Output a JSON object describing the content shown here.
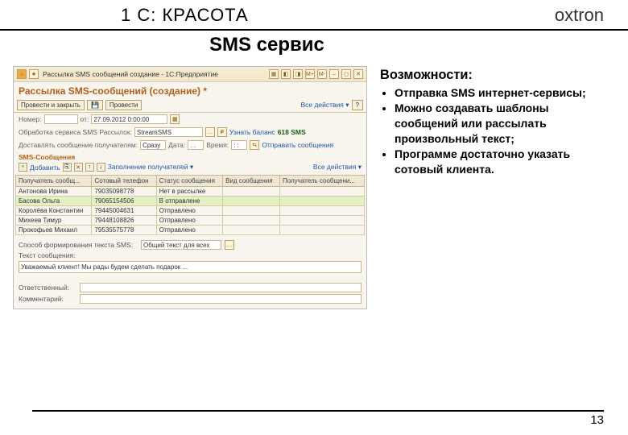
{
  "header": {
    "title": "1 С: КРАСОТА",
    "logo": "oxtron"
  },
  "service_title": "SMS сервис",
  "window": {
    "bar_title": "Рассылка SMS сообщений создание - 1С:Предприятие",
    "form_title": "Рассылка SMS-сообщений (создание) *"
  },
  "toolbar": {
    "action1": "Провести и закрыть",
    "action2": "Провести",
    "all_actions": "Все действия ▾"
  },
  "form": {
    "number_label": "Номер:",
    "date_label": "от:",
    "date_value": "27.09.2012 0:00:00",
    "provider_label": "Обработка сервиса SMS Рассылок:",
    "provider_value": "StreamSMS",
    "balance": "618 SMS",
    "balance_btn": "Узнать баланс",
    "prepare_label": "Доставлять сообщение получателям:",
    "prepare_value": "Сразу",
    "date2_label": "Дата:",
    "time_label": "Время:",
    "send_btn": "Отправить сообщения"
  },
  "section": "SMS-Сообщения",
  "subtoolbar": {
    "add": "Добавить",
    "fill": "Заполнение получателей ▾",
    "all": "Все действия ▾"
  },
  "grid": {
    "headers": [
      "Получатель сообщ...",
      "Сотовый телефон",
      "Статус сообщения",
      "Вид сообщения",
      "Получатель сообщени..."
    ],
    "rows": [
      [
        "Антонова Ирина",
        "79035098778",
        "Нет в рассылке",
        "",
        ""
      ],
      [
        "Басова Ольга",
        "79065154506",
        "В отправлене",
        "",
        ""
      ],
      [
        "Королёва Константин",
        "79445004631",
        "Отправлено",
        "",
        ""
      ],
      [
        "Михеев Тимур",
        "79448108826",
        "Отправлено",
        "",
        ""
      ],
      [
        "Прокофьев Михаил",
        "79535575778",
        "Отправлено",
        "",
        ""
      ]
    ]
  },
  "form2": {
    "method_label": "Способ формирования текста SMS:",
    "method_value": "Общий текст для всех",
    "text_label": "Текст сообщения:",
    "text_value": "Уважаемый клиент! Мы рады будем сделать подарок ...",
    "responsible_label": "Ответственный:",
    "comment_label": "Комментарий:"
  },
  "features": {
    "title": "Возможности:",
    "items": [
      "Отправка SMS интернет-сервисы;",
      "Можно создавать шаблоны сообщений или рассылать произвольный текст;",
      "Программе достаточно указать сотовый клиента."
    ]
  },
  "footer": {
    "page": "13"
  }
}
